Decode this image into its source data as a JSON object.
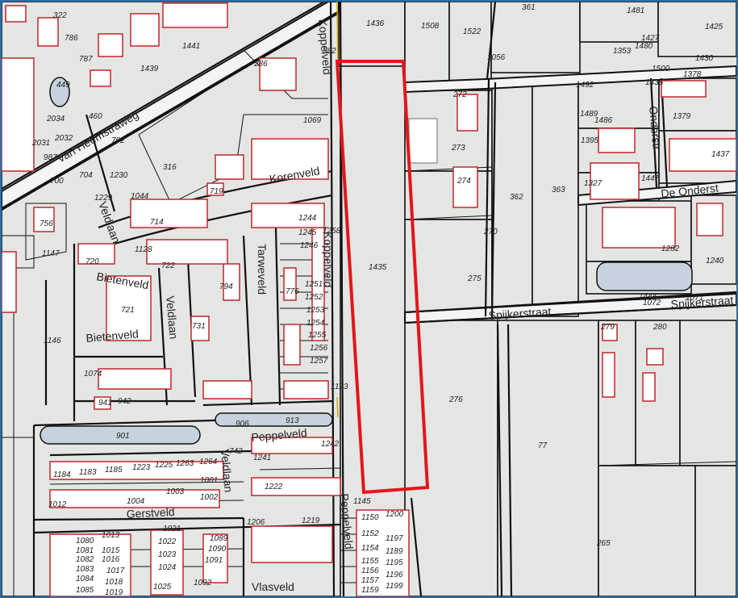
{
  "map": {
    "streets": {
      "van_heemstraweg": "Van Heemstraweg",
      "koppelveld": "Koppelveld",
      "korenveld": "Korenveld",
      "tarweveld": "Tarweveld",
      "veldlaan": "Veldlaan",
      "bietenveld": "Bietenveld",
      "peppelveld": "Peppelveld",
      "gerstveld": "Gerstveld",
      "vlasveld": "Vlasveld",
      "spijkerstraat": "Spijkerstraat",
      "de_onderstraat": "De Onderst",
      "onderstr": "Onderstr"
    },
    "parcel_numbers": {
      "p1435": "1435",
      "p1436": "1436",
      "p1508": "1508",
      "p1522": "1522",
      "p361": "361",
      "p1481": "1481",
      "p1425": "1425",
      "p1427": "1427",
      "p1353": "1353",
      "p1480": "1480",
      "p1056": "1056",
      "p1430": "1430",
      "p1378": "1378",
      "p1379": "1379",
      "p1395": "1395",
      "p1437": "1437",
      "p1327": "1327",
      "p1447": "1447",
      "p272": "272",
      "p273": "273",
      "p274": "274",
      "p362": "362",
      "p363": "363",
      "p270": "270",
      "p275": "275",
      "p1282": "1282",
      "p1240": "1240",
      "p1071": "1071",
      "p279": "279",
      "p280": "280",
      "p276": "276",
      "p77": "77",
      "p265": "265",
      "p322": "322",
      "p786": "786",
      "p787": "787",
      "p1439": "1439",
      "p1441": "1441",
      "p449": "449",
      "p460": "460",
      "p286": "286",
      "p882": "882",
      "p2034": "2034",
      "p2032": "2032",
      "p2031": "2031",
      "p702": "702",
      "p987": "987",
      "p700": "700",
      "p704": "704",
      "p1230": "1230",
      "p316": "316",
      "p1044": "1044",
      "p1229": "1229",
      "p756": "756",
      "p1147": "1147",
      "p720": "720",
      "p721": "721",
      "p1146": "1146",
      "p1128": "1128",
      "p714": "714",
      "p719": "719",
      "p722": "722",
      "p794": "794",
      "p731": "731",
      "p776": "776",
      "p1258": "1258",
      "p1244": "1244",
      "p1245": "1245",
      "p1246": "1246",
      "p1251": "1251",
      "p1252": "1252",
      "p1253": "1253",
      "p1254": "1254",
      "p1255": "1255",
      "p1256": "1256",
      "p1257": "1257",
      "p1123": "1123",
      "p1069": "1069",
      "p1074": "1074",
      "p941": "941",
      "p942": "942",
      "p901": "901",
      "p906": "906",
      "p913": "913",
      "p1184": "1184",
      "p1183": "1183",
      "p1185": "1185",
      "p1223": "1223",
      "p1225": "1225",
      "p1263": "1263",
      "p1264": "1264",
      "p1242": "1242",
      "p1241": "1241",
      "p1222": "1222",
      "p1003": "1003",
      "p1004": "1004",
      "p1012": "1012",
      "p1001": "1001",
      "p1002": "1002",
      "p742": "742",
      "p1145": "1145",
      "p1150": "1150",
      "p1200": "1200",
      "p1152": "1152",
      "p1197": "1197",
      "p1154": "1154",
      "p1189": "1189",
      "p1155": "1155",
      "p1195": "1195",
      "p1156": "1156",
      "p1196": "1196",
      "p1157": "1157",
      "p1159": "1159",
      "p1199": "1199",
      "p1206": "1206",
      "p1219": "1219",
      "p1080": "1080",
      "p1013": "1013",
      "p1081": "1081",
      "p1015": "1015",
      "p1082": "1082",
      "p1016": "1016",
      "p1083": "1083",
      "p1017": "1017",
      "p1084": "1084",
      "p1018": "1018",
      "p1085": "1085",
      "p1019": "1019",
      "p1021": "1021",
      "p1022": "1022",
      "p1023": "1023",
      "p1024": "1024",
      "p1025": "1025",
      "p1089": "1089",
      "p1090": "1090",
      "p1091": "1091",
      "p1092": "1092",
      "p1489": "1489",
      "p1486": "1486",
      "p1492": "1492",
      "p1436b": "1436",
      "p1500": "1500",
      "p1444": "1444",
      "p1072": "1072"
    },
    "highlight_color": "#e3161b",
    "building_color": "#c0272d"
  }
}
